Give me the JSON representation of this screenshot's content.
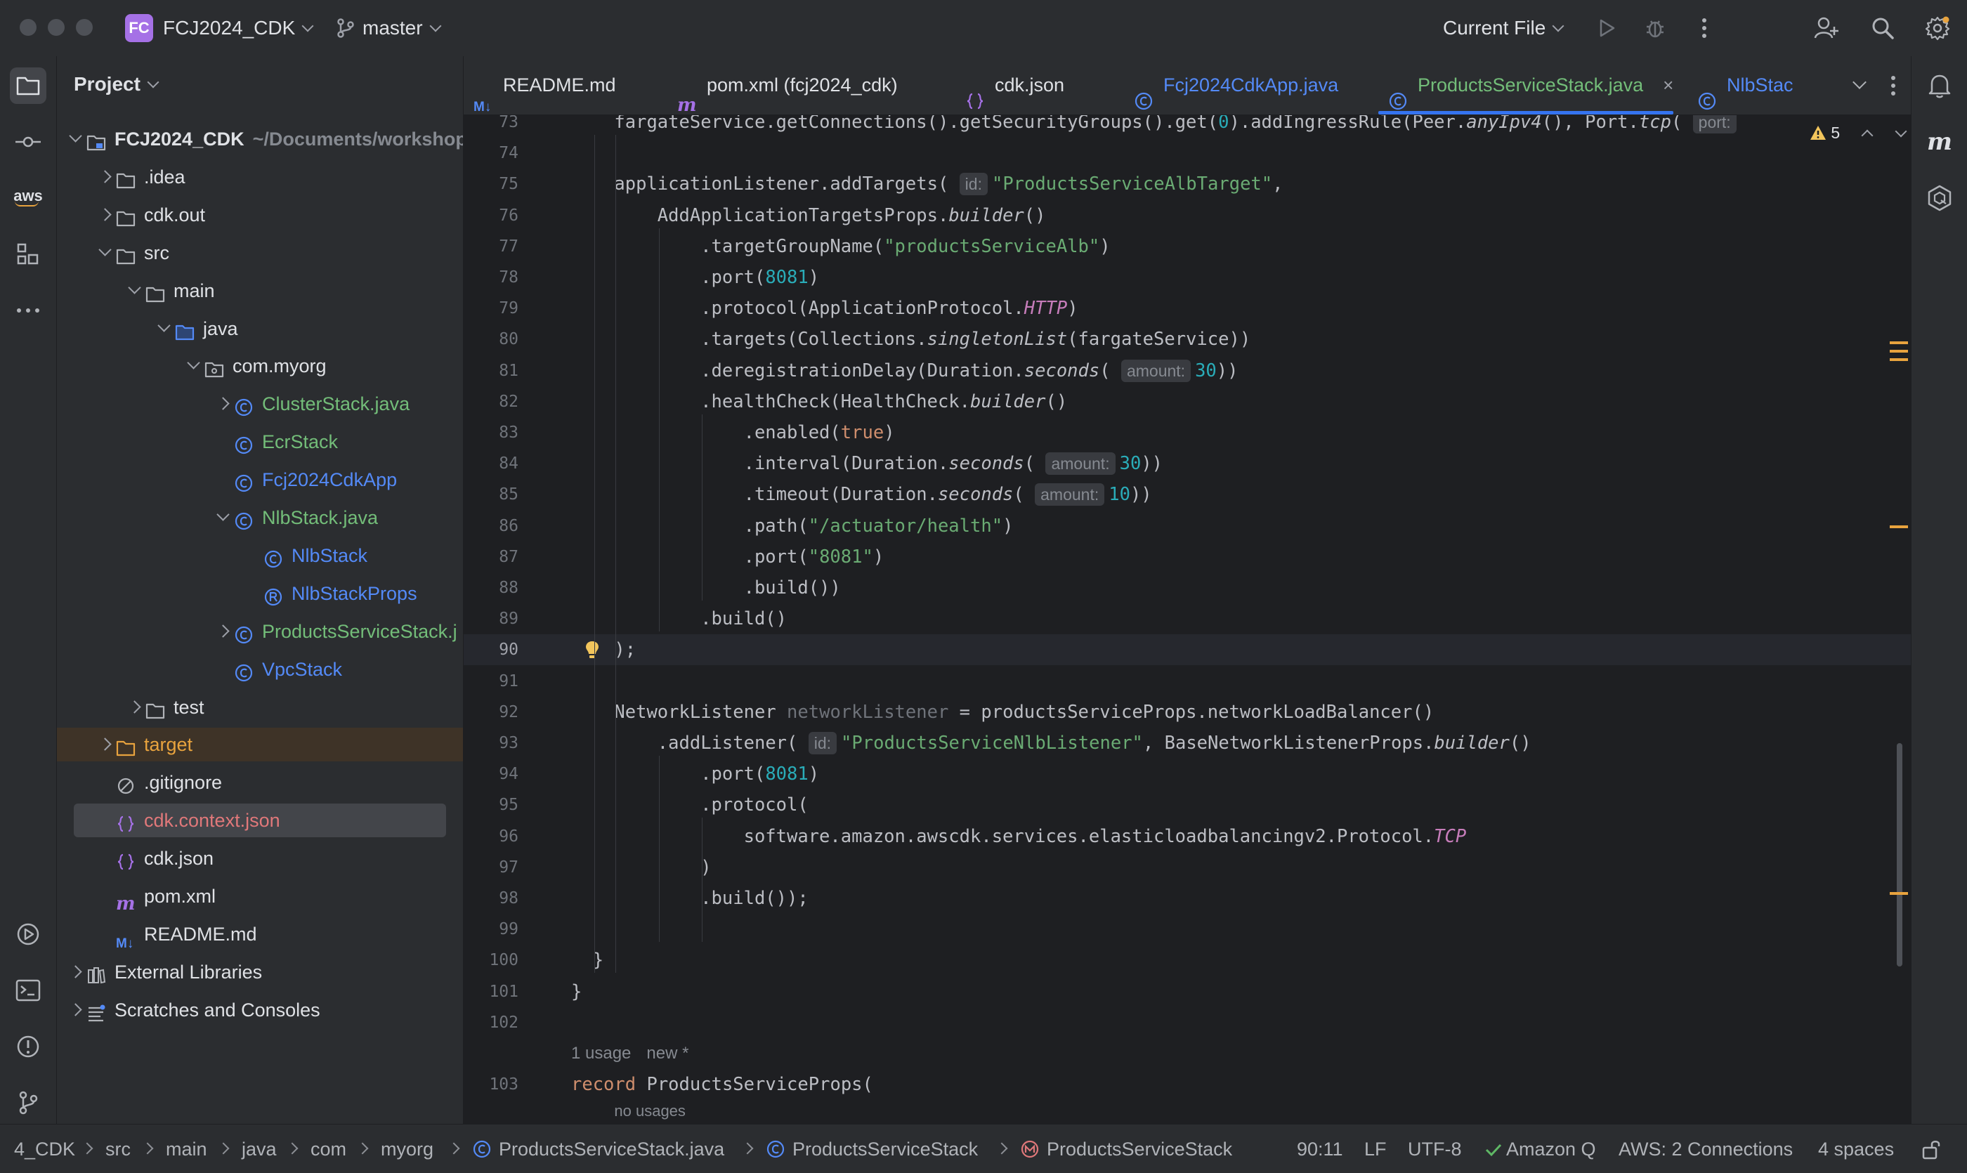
{
  "titlebar": {
    "project_badge": "FC",
    "project_name": "FCJ2024_CDK",
    "branch": "master",
    "run_config": "Current File"
  },
  "project_panel": {
    "title": "Project",
    "tree": [
      {
        "label": "FCJ2024_CDK",
        "extra": "~/Documents/workshop",
        "depth": 0,
        "arrow": "down",
        "icon": "module-folder-icon",
        "color": "#dfe1e5",
        "bold": true
      },
      {
        "label": ".idea",
        "depth": 1,
        "arrow": "right",
        "icon": "folder-icon",
        "color": "#dfe1e5"
      },
      {
        "label": "cdk.out",
        "depth": 1,
        "arrow": "right",
        "icon": "folder-icon",
        "color": "#dfe1e5"
      },
      {
        "label": "src",
        "depth": 1,
        "arrow": "down",
        "icon": "folder-icon",
        "color": "#dfe1e5"
      },
      {
        "label": "main",
        "depth": 2,
        "arrow": "down",
        "icon": "folder-icon",
        "color": "#dfe1e5"
      },
      {
        "label": "java",
        "depth": 3,
        "arrow": "down",
        "icon": "source-folder-icon",
        "color": "#dfe1e5"
      },
      {
        "label": "com.myorg",
        "depth": 4,
        "arrow": "down",
        "icon": "package-icon",
        "color": "#dfe1e5"
      },
      {
        "label": "ClusterStack.java",
        "depth": 5,
        "arrow": "right",
        "icon": "class-icon",
        "color": "#73bd79"
      },
      {
        "label": "EcrStack",
        "depth": 5,
        "arrow": "",
        "icon": "class-icon",
        "color": "#73bd79"
      },
      {
        "label": "Fcj2024CdkApp",
        "depth": 5,
        "arrow": "",
        "icon": "class-icon",
        "color": "#548af7"
      },
      {
        "label": "NlbStack.java",
        "depth": 5,
        "arrow": "down",
        "icon": "class-icon",
        "color": "#73bd79"
      },
      {
        "label": "NlbStack",
        "depth": 6,
        "arrow": "",
        "icon": "class-icon",
        "color": "#548af7"
      },
      {
        "label": "NlbStackProps",
        "depth": 6,
        "arrow": "",
        "icon": "record-icon",
        "color": "#548af7"
      },
      {
        "label": "ProductsServiceStack.j",
        "depth": 5,
        "arrow": "right",
        "icon": "class-icon",
        "color": "#73bd79"
      },
      {
        "label": "VpcStack",
        "depth": 5,
        "arrow": "",
        "icon": "class-icon",
        "color": "#548af7"
      },
      {
        "label": "test",
        "depth": 2,
        "arrow": "right",
        "icon": "folder-icon",
        "color": "#dfe1e5"
      },
      {
        "label": "target",
        "depth": 1,
        "arrow": "right",
        "icon": "excluded-folder-icon",
        "color": "#e8a33e",
        "excluded": true
      },
      {
        "label": ".gitignore",
        "depth": 1,
        "arrow": "",
        "icon": "ignore-file-icon",
        "color": "#dfe1e5"
      },
      {
        "label": "cdk.context.json",
        "depth": 1,
        "arrow": "",
        "icon": "json-icon",
        "color": "#e0787a",
        "selected": true
      },
      {
        "label": "cdk.json",
        "depth": 1,
        "arrow": "",
        "icon": "json-icon",
        "color": "#dfe1e5"
      },
      {
        "label": "pom.xml",
        "depth": 1,
        "arrow": "",
        "icon": "maven-icon",
        "color": "#dfe1e5"
      },
      {
        "label": "README.md",
        "depth": 1,
        "arrow": "",
        "icon": "markdown-icon",
        "color": "#dfe1e5"
      },
      {
        "label": "External Libraries",
        "depth": 0,
        "arrow": "right",
        "icon": "library-icon",
        "color": "#dfe1e5"
      },
      {
        "label": "Scratches and Consoles",
        "depth": 0,
        "arrow": "right",
        "icon": "scratches-icon",
        "color": "#dfe1e5"
      }
    ]
  },
  "tabs": [
    {
      "label": "README.md",
      "icon": "markdown-icon",
      "active": false
    },
    {
      "label": "pom.xml (fcj2024_cdk)",
      "icon": "maven-icon",
      "active": false
    },
    {
      "label": "cdk.json",
      "icon": "json-icon",
      "active": false
    },
    {
      "label": "Fcj2024CdkApp.java",
      "icon": "class-icon",
      "active": false,
      "color": "#548af7"
    },
    {
      "label": "ProductsServiceStack.java",
      "icon": "class-icon",
      "active": true,
      "color": "#73bd79"
    },
    {
      "label": "NlbStac",
      "icon": "class-icon",
      "active": false,
      "color": "#548af7"
    }
  ],
  "editor": {
    "warning_count": "5",
    "usage_lens": "1 usage",
    "new_lens": "new *",
    "no_usages": "no usages",
    "lines": [
      {
        "num": "73",
        "indent": 4,
        "html": "fargateService.getConnections().getSecurityGroups().get(<span class='n'>0</span>).addIngressRule(Peer.<span class='it'>anyIpv4</span>(), Port.<span class='it'>tcp</span>( <span class='hint'>port:</span>"
      },
      {
        "num": "74",
        "indent": 0,
        "html": ""
      },
      {
        "num": "75",
        "indent": 4,
        "html": "applicationListener.addTargets( <span class='hint'>id:</span><span class='s'>\"ProductsServiceAlbTarget\"</span>,"
      },
      {
        "num": "76",
        "indent": 8,
        "html": "AddApplicationTargetsProps.<span class='it'>builder</span>()"
      },
      {
        "num": "77",
        "indent": 12,
        "html": ".targetGroupName(<span class='s'>\"productsServiceAlb\"</span>)"
      },
      {
        "num": "78",
        "indent": 12,
        "html": ".port(<span class='n'>8081</span>)"
      },
      {
        "num": "79",
        "indent": 12,
        "html": ".protocol(ApplicationProtocol.<span class='cst'>HTTP</span>)"
      },
      {
        "num": "80",
        "indent": 12,
        "html": ".targets(Collections.<span class='it'>singletonList</span>(fargateService))"
      },
      {
        "num": "81",
        "indent": 12,
        "html": ".deregistrationDelay(Duration.<span class='it'>seconds</span>( <span class='hint'>amount:</span><span class='n'>30</span>))"
      },
      {
        "num": "82",
        "indent": 12,
        "html": ".healthCheck(HealthCheck.<span class='it'>builder</span>()"
      },
      {
        "num": "83",
        "indent": 16,
        "html": ".enabled(<span class='k'>true</span>)"
      },
      {
        "num": "84",
        "indent": 16,
        "html": ".interval(Duration.<span class='it'>seconds</span>( <span class='hint'>amount:</span><span class='n'>30</span>))"
      },
      {
        "num": "85",
        "indent": 16,
        "html": ".timeout(Duration.<span class='it'>seconds</span>( <span class='hint'>amount:</span><span class='n'>10</span>))"
      },
      {
        "num": "86",
        "indent": 16,
        "html": ".path(<span class='s'>\"/actuator/health\"</span>)"
      },
      {
        "num": "87",
        "indent": 16,
        "html": ".port(<span class='s'>\"8081\"</span>)"
      },
      {
        "num": "88",
        "indent": 16,
        "html": ".build())"
      },
      {
        "num": "89",
        "indent": 12,
        "html": ".build()"
      },
      {
        "num": "90",
        "indent": 4,
        "html": ");",
        "current": true
      },
      {
        "num": "91",
        "indent": 0,
        "html": ""
      },
      {
        "num": "92",
        "indent": 4,
        "html": "NetworkListener <span class='gray'>networkListener</span> = productsServiceProps.networkLoadBalancer()"
      },
      {
        "num": "93",
        "indent": 8,
        "html": ".addListener( <span class='hint'>id:</span><span class='s'>\"ProductsServiceNlbListener\"</span>, BaseNetworkListenerProps.<span class='it'>builder</span>()"
      },
      {
        "num": "94",
        "indent": 12,
        "html": ".port(<span class='n'>8081</span>)"
      },
      {
        "num": "95",
        "indent": 12,
        "html": ".protocol("
      },
      {
        "num": "96",
        "indent": 16,
        "html": "software.amazon.awscdk.services.elasticloadbalancingv2.Protocol.<span class='cst'>TCP</span>"
      },
      {
        "num": "97",
        "indent": 12,
        "html": ")"
      },
      {
        "num": "98",
        "indent": 12,
        "html": ".build());"
      },
      {
        "num": "99",
        "indent": 0,
        "html": ""
      },
      {
        "num": "100",
        "indent": 2,
        "html": "}"
      },
      {
        "num": "101",
        "indent": 0,
        "html": "}"
      },
      {
        "num": "102",
        "indent": 0,
        "html": ""
      },
      {
        "num": "",
        "indent": 0,
        "html": "",
        "lens": true
      },
      {
        "num": "103",
        "indent": 0,
        "html": "<span class='k'>record</span> ProductsServiceProps("
      }
    ]
  },
  "status": {
    "breadcrumbs": [
      "4_CDK",
      "src",
      "main",
      "java",
      "com",
      "myorg",
      "ProductsServiceStack.java",
      "ProductsServiceStack",
      "ProductsServiceStack"
    ],
    "position": "90:11",
    "line_sep": "LF",
    "encoding": "UTF-8",
    "amazon_q": "Amazon Q",
    "aws": "AWS: 2 Connections",
    "indent": "4 spaces"
  },
  "colors": {
    "accent": "#3574f0",
    "class_green": "#73bd79",
    "class_blue": "#548af7",
    "warning": "#f2c55c"
  }
}
